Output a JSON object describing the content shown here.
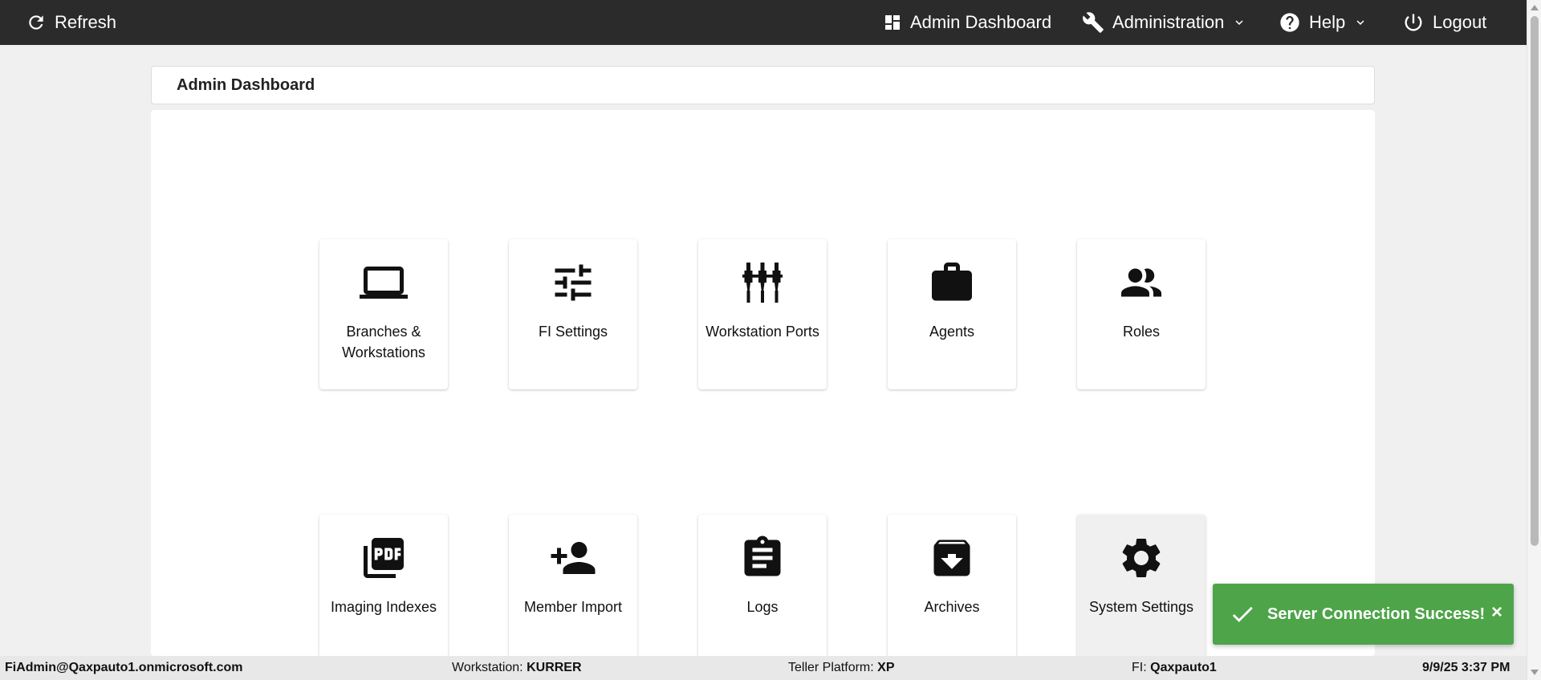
{
  "topbar": {
    "refresh_label": "Refresh",
    "admin_dashboard_label": "Admin Dashboard",
    "administration_label": "Administration",
    "help_label": "Help",
    "logout_label": "Logout"
  },
  "page": {
    "title": "Admin Dashboard"
  },
  "tiles": [
    {
      "label": "Branches & Workstations",
      "icon": "laptop-icon"
    },
    {
      "label": "FI Settings",
      "icon": "sliders-icon"
    },
    {
      "label": "Workstation Ports",
      "icon": "ports-icon"
    },
    {
      "label": "Agents",
      "icon": "briefcase-icon"
    },
    {
      "label": "Roles",
      "icon": "people-icon"
    },
    {
      "label": "Imaging Indexes",
      "icon": "pdf-icon"
    },
    {
      "label": "Member Import",
      "icon": "add-person-icon"
    },
    {
      "label": "Logs",
      "icon": "clipboard-icon"
    },
    {
      "label": "Archives",
      "icon": "archive-icon"
    },
    {
      "label": "System Settings",
      "icon": "gear-icon"
    }
  ],
  "toast": {
    "message": "Server Connection Success!",
    "close": "×",
    "color": "#4ea449"
  },
  "status": {
    "user": "FiAdmin@Qaxpauto1.onmicrosoft.com",
    "workstation_label": "Workstation:",
    "workstation_value": "KURRER",
    "platform_label": "Teller Platform:",
    "platform_value": "XP",
    "fi_label": "FI:",
    "fi_value": "Qaxpauto1",
    "datetime": "9/9/25 3:37 PM"
  }
}
